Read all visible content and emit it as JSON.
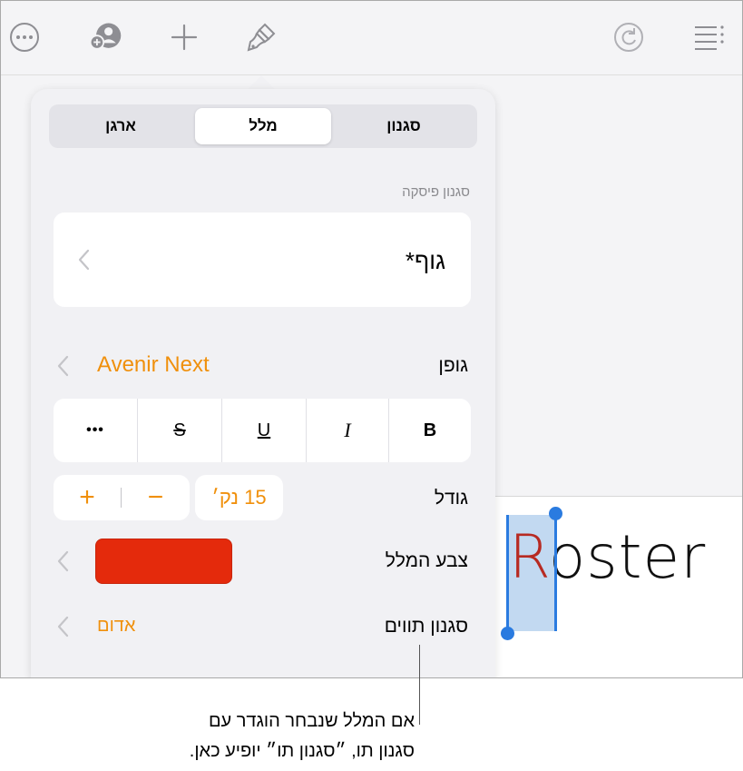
{
  "toolbar": {
    "buttons": [
      "more-icon",
      "collaborate-icon",
      "add-icon",
      "format-brush-icon",
      "undo-icon",
      "document-outline-icon"
    ]
  },
  "document": {
    "title_first_letter": "R",
    "title_rest": "oster"
  },
  "format_panel": {
    "tabs": [
      "סגנון",
      "מלל",
      "ארגן"
    ],
    "active_tab": "מלל",
    "paragraph_style": {
      "section_label": "סגנון פיסקה",
      "value": "גוף*"
    },
    "font": {
      "label": "גופן",
      "value": "Avenir Next"
    },
    "text_styles": {
      "bold": "B",
      "italic": "I",
      "underline": "U",
      "strikethrough": "S",
      "more": "•••"
    },
    "size": {
      "label": "גודל",
      "value": "15 נק׳",
      "increase": "+",
      "decrease": "−"
    },
    "text_color": {
      "label": "צבע המלל",
      "swatch": "#e42a0c"
    },
    "character_style": {
      "label": "סגנון תווים",
      "value": "אדום"
    }
  },
  "caption": {
    "line1": "אם המלל שנבחר הוגדר עם",
    "line2": "סגנון תו, ״סגנון תו״ יופיע כאן."
  },
  "colors": {
    "accent": "#f0900c",
    "selection": "#2a7be0",
    "title_red": "#b72a22"
  }
}
